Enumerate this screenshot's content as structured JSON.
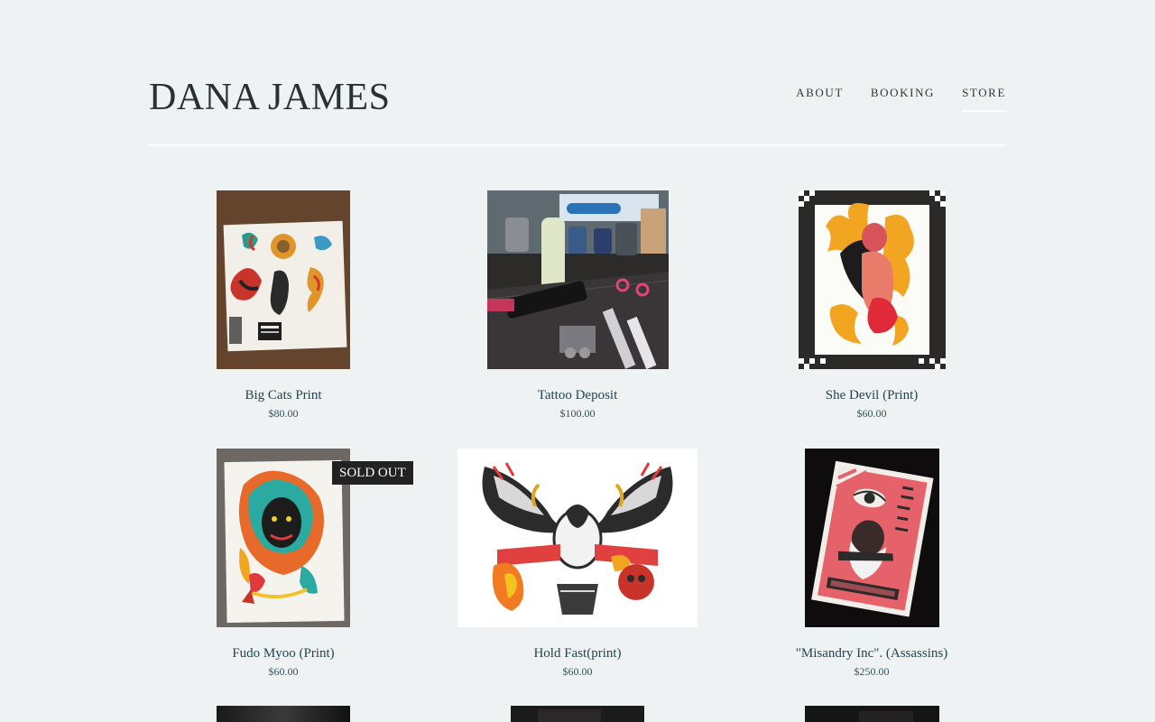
{
  "site": {
    "title": "DANA JAMES"
  },
  "nav": [
    {
      "label": "ABOUT"
    },
    {
      "label": "BOOKING"
    },
    {
      "label": "STORE"
    }
  ],
  "products": [
    {
      "name": "Big Cats Print",
      "price": "$80.00",
      "sold_out": false
    },
    {
      "name": "Tattoo Deposit",
      "price": "$100.00",
      "sold_out": false
    },
    {
      "name": "She Devil (Print)",
      "price": "$60.00",
      "sold_out": false
    },
    {
      "name": "Fudo Myoo (Print)",
      "price": "$60.00",
      "sold_out": true,
      "badge": "SOLD OUT"
    },
    {
      "name": "Hold Fast(print)",
      "price": "$60.00",
      "sold_out": false
    },
    {
      "name": "\"Misandry Inc\". (Assassins)",
      "price": "$250.00",
      "sold_out": false
    }
  ],
  "icons": {
    "big_cats": "tattoo-flash-sheet-image",
    "deposit": "tattoo-machine-image",
    "she_devil": "devil-girl-flash-image",
    "fudo_myoo": "fudo-myoo-flash-image",
    "hold_fast": "eagle-flash-image",
    "misandry": "misandry-flash-image"
  }
}
